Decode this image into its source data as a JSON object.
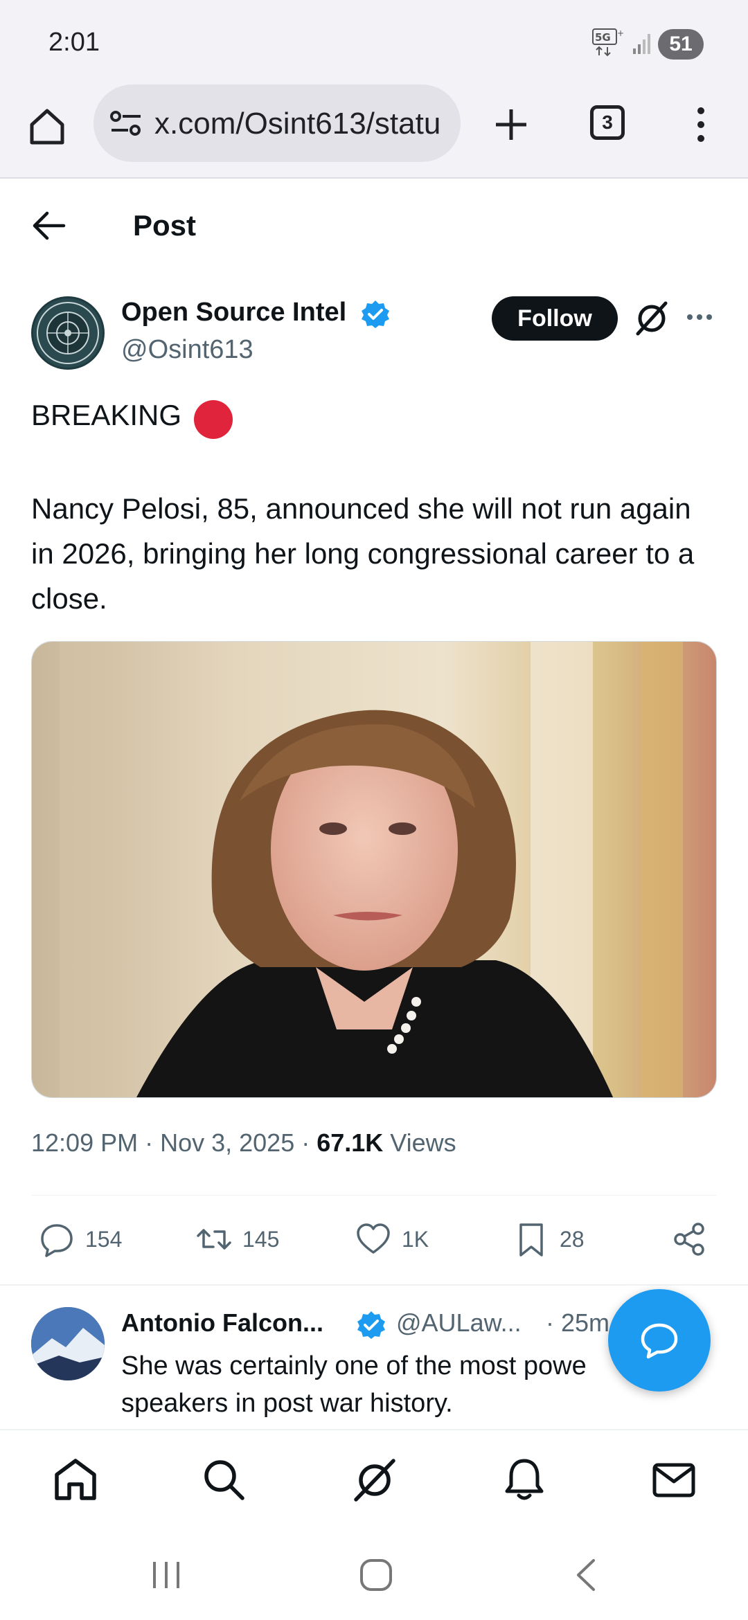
{
  "status_bar": {
    "time": "2:01",
    "network": "5G+",
    "battery": "51"
  },
  "browser": {
    "url": "x.com/Osint613/statu",
    "tab_count": "3"
  },
  "header": {
    "title": "Post"
  },
  "post": {
    "author_name": "Open Source Intel",
    "author_handle": "@Osint613",
    "follow_label": "Follow",
    "breaking_text": "BREAKING",
    "body": "Nancy Pelosi, 85, announced she will not run again in 2026, bringing her long congressional career to a close.",
    "time": "12:09 PM · Nov 3, 2025 · ",
    "views_count": "67.1K",
    "views_label": " Views",
    "stats": {
      "replies": "154",
      "reposts": "145",
      "likes": "1K",
      "bookmarks": "28"
    }
  },
  "reply": {
    "author_name": "Antonio Falcon...",
    "author_handle": "@AULaw...",
    "time": "· 25m",
    "text": "She was certainly one of the most powe speakers in post war history."
  },
  "colors": {
    "accent": "#1d9bf0",
    "breaking_dot": "#e0243b",
    "follow_bg": "#0f1419"
  },
  "icons": [
    "home-icon",
    "search-icon",
    "grok-icon",
    "notifications-icon",
    "messages-icon"
  ]
}
